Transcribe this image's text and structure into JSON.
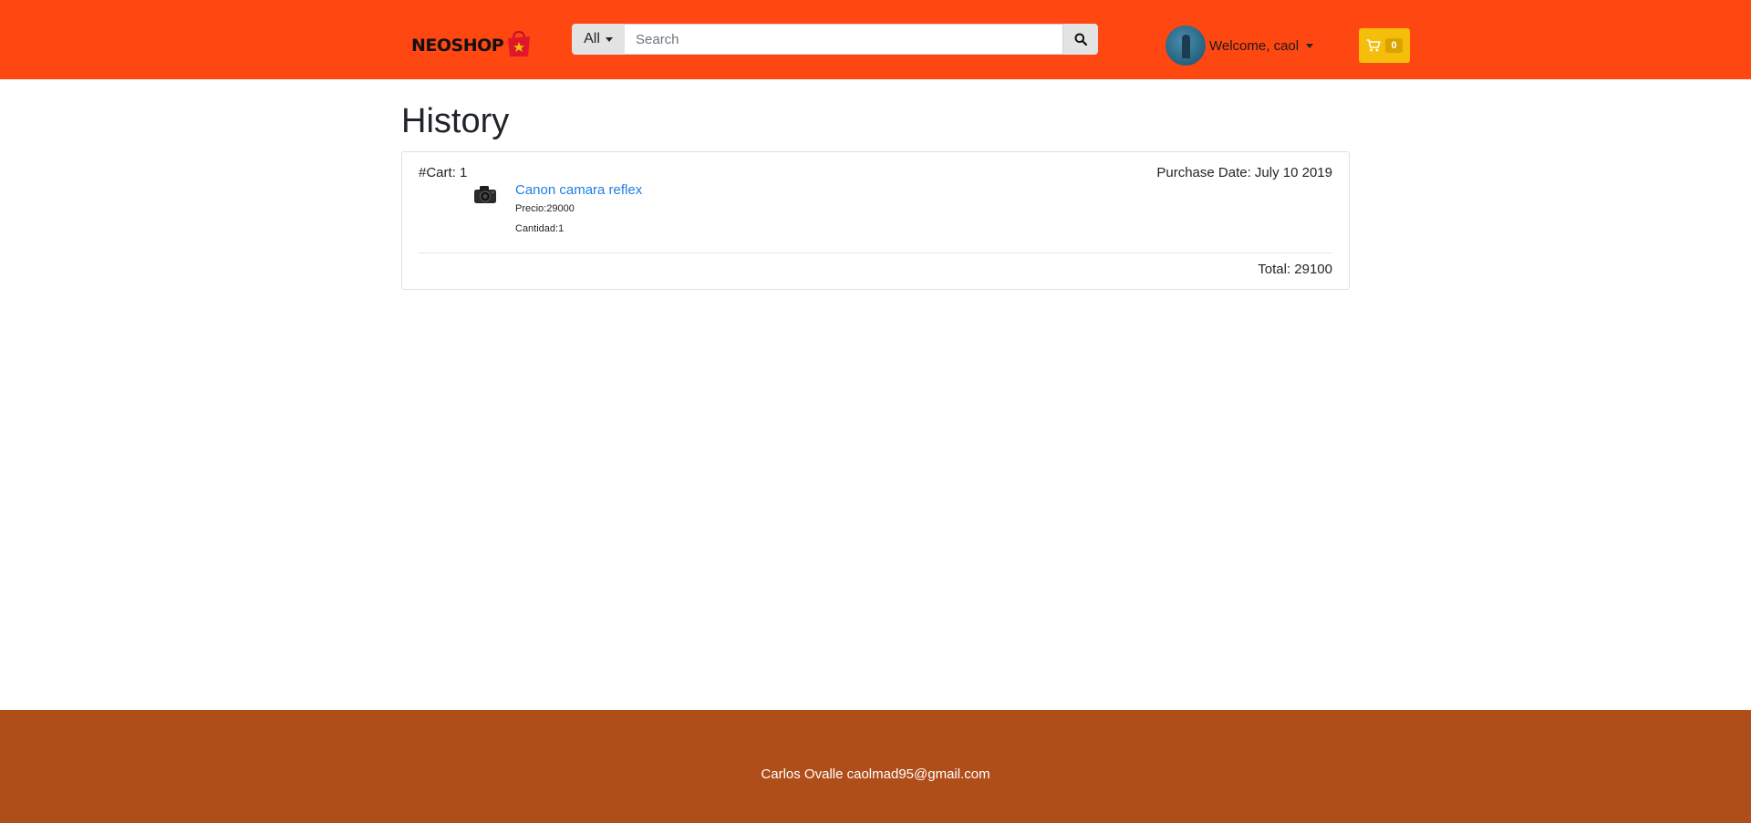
{
  "header": {
    "logo_text": "NEOSHOP",
    "category_label": "All",
    "search_placeholder": "Search",
    "welcome_text": "Welcome, caol",
    "cart_count": "0",
    "colors": {
      "topbar": "#ff4712",
      "cart_button": "#f5be0b"
    },
    "icons": [
      "shopping-bag-icon",
      "chevron-down-icon",
      "search-icon",
      "avatar",
      "cart-icon"
    ]
  },
  "main": {
    "title": "History",
    "carts": [
      {
        "cart_label": "#Cart: 1",
        "purchase_date": "Purchase Date: July 10 2019",
        "items": [
          {
            "name": "Canon camara reflex",
            "price": "Precio:29000",
            "quantity": "Cantidad:1",
            "icon": "camera-icon"
          }
        ],
        "total": "Total: 29100"
      }
    ]
  },
  "footer": {
    "text": "Carlos Ovalle caolmad95@gmail.com",
    "color": "#b04e1a"
  }
}
